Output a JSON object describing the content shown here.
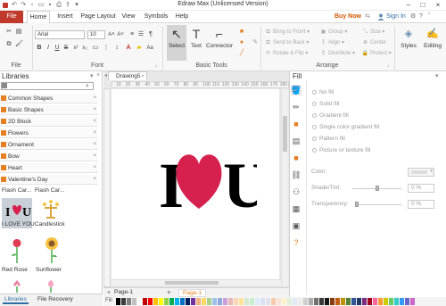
{
  "app": {
    "title": "Edraw Max (Unlicensed Version)"
  },
  "menu": {
    "file": "File",
    "items": [
      "Home",
      "Insert",
      "Page Layout",
      "View",
      "Symbols",
      "Help"
    ],
    "buy_now": "Buy Now",
    "sign_in": "Sign In"
  },
  "ribbon": {
    "font_name": "Arial",
    "font_size": "10",
    "groups": {
      "file": "File",
      "font": "Font",
      "basic_tools": "Basic Tools",
      "arrange": "Arrange"
    },
    "tools": {
      "select": "Select",
      "text": "Text",
      "connector": "Connector",
      "styles": "Styles",
      "editing": "Editing"
    },
    "arrange": {
      "bring_to_front": "Bring to Front",
      "send_to_back": "Send to Back",
      "rotate_flip": "Rotate & Flip",
      "group": "Group",
      "align": "Align",
      "distribute": "Distribute",
      "size": "Size",
      "center": "Center",
      "protect": "Protect"
    }
  },
  "libraries": {
    "title": "Libraries",
    "categories": [
      "Common Shapes",
      "Basic Shapes",
      "2D Block",
      "Flowers",
      "Ornament",
      "Bow",
      "Heart",
      "Valentine's Day"
    ],
    "thumb_headers": [
      "Flash Car...",
      "Flash Car..."
    ],
    "thumbs": [
      "I LOVE YOU",
      "Candlestick",
      "Red Rose",
      "Sunflower"
    ],
    "bottom_tabs": [
      "Libraries",
      "File Recovery"
    ]
  },
  "document": {
    "tab": "Drawing5",
    "ruler_marks": [
      "10",
      "20",
      "30",
      "40",
      "50",
      "60",
      "70",
      "80",
      "90",
      "100",
      "110",
      "120",
      "130",
      "140",
      "150",
      "160",
      "170",
      "180"
    ],
    "art": {
      "left": "I",
      "right": "U",
      "heart_color": "#d6214f"
    },
    "pages": {
      "tab": "Page-1",
      "active": "Page-1"
    }
  },
  "fill_panel": {
    "title": "Fill",
    "options": [
      "No fill",
      "Solid fill",
      "Gradient fill",
      "Single color gradient fill",
      "Pattern fill",
      "Picture or texture fill"
    ],
    "color_label": "Color:",
    "shade_label": "Shade/Tint:",
    "shade_value": "0 %",
    "transparency_label": "Transparency:",
    "transparency_value": "0 %"
  },
  "palette": {
    "label": "Fill",
    "colors": [
      "#000000",
      "#3b3b3b",
      "#7f7f7f",
      "#bfbfbf",
      "#ffffff",
      "#c00000",
      "#ff0000",
      "#ffc000",
      "#ffff00",
      "#92d050",
      "#00b050",
      "#00b0f0",
      "#0070c0",
      "#002060",
      "#7030a0",
      "#f4b183",
      "#ffd966",
      "#a9d18e",
      "#9dc3e6",
      "#8faadc",
      "#c9a0dc",
      "#e6b8b7",
      "#fcd5b4",
      "#ffe699",
      "#d9ead3",
      "#c6efce",
      "#ddebf7",
      "#d9e1f2",
      "#e4dfec",
      "#f8cbad",
      "#fbe5d6",
      "#fff2cc",
      "#e2efda",
      "#deebf7",
      "#ededed",
      "#d0cece",
      "#aeaaaa",
      "#757171",
      "#3a3838",
      "#161616",
      "#843c0c",
      "#c55a11",
      "#bf9000",
      "#538135",
      "#2f5597",
      "#203864",
      "#7b2c82",
      "#a50021",
      "#ff6699",
      "#ff9933",
      "#cccc00",
      "#66cc66",
      "#33cccc",
      "#3399ff",
      "#6666cc",
      "#cc66cc"
    ]
  }
}
